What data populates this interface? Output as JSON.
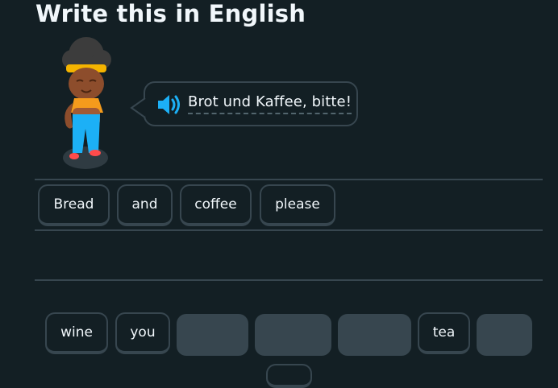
{
  "challenge": {
    "title": "Write this in English",
    "prompt": "Brot und Kaffee, bitte!",
    "speaker_icon": "speaker-icon"
  },
  "answer_chips": [
    "Bread",
    "and",
    "coffee",
    "please"
  ],
  "word_bank": {
    "wine": "wine",
    "you": "you",
    "tea": "tea"
  },
  "colors": {
    "background": "#131f24",
    "border": "#37464f",
    "text": "#f1f7fb",
    "speaker": "#1cb0f6",
    "slot": "#37464f"
  }
}
